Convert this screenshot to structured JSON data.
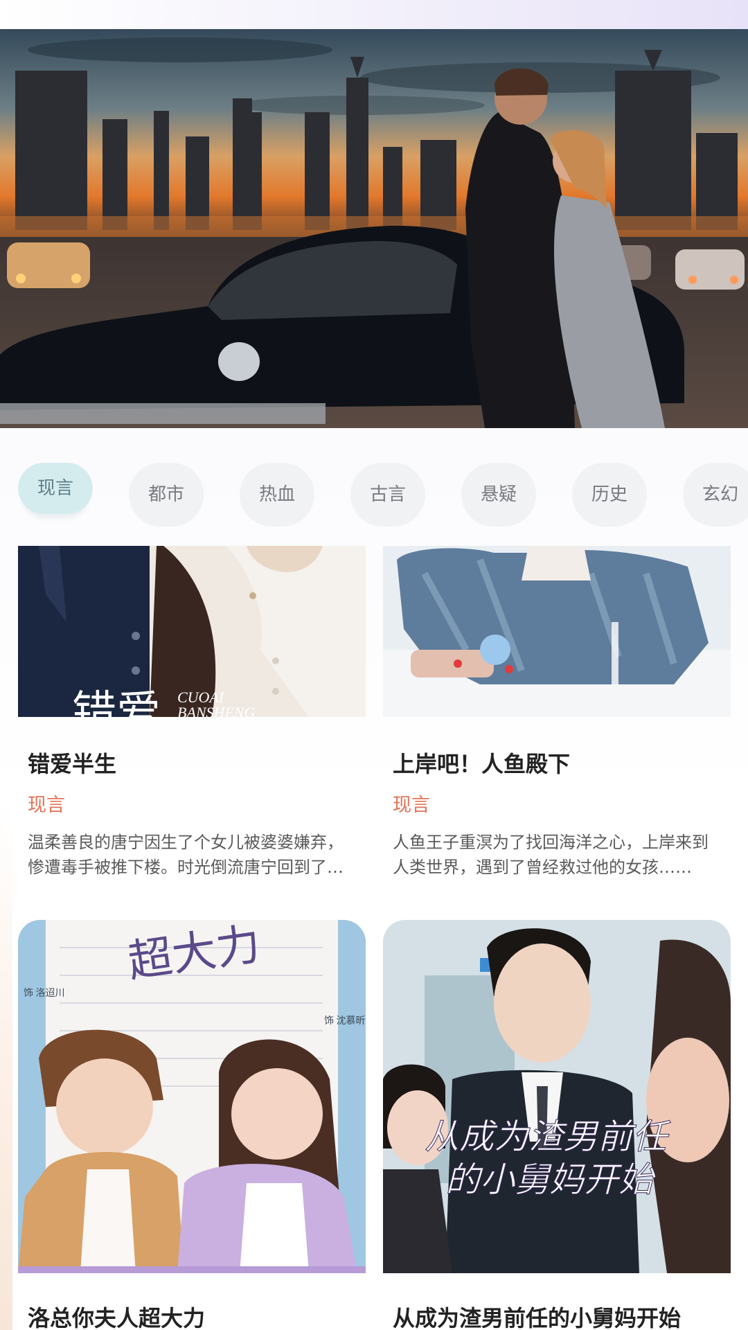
{
  "categories": [
    "现言",
    "都市",
    "热血",
    "古言",
    "悬疑",
    "历史",
    "玄幻"
  ],
  "active_category": "现言",
  "cards": [
    {
      "title": "错爱半生",
      "genre": "现言",
      "description": "温柔善良的唐宁因生了个女儿被婆婆嫌弃，惨遭毒手被推下楼。时光倒流唐宁回到了过去，这一次她决定改写自己和女儿的命运……",
      "cover_text_main": "错爱",
      "cover_text_sub1": "CUOAI",
      "cover_text_sub2": "BANSHENG"
    },
    {
      "title": "上岸吧！人鱼殿下",
      "genre": "现言",
      "description": "人鱼王子重溟为了找回海洋之心，上岸来到人类世界，遇到了曾经救过他的女孩……",
      "cover_text_main": "",
      "cover_text_sub1": "",
      "cover_text_sub2": ""
    },
    {
      "title": "洛总你夫人超大力",
      "genre": "",
      "description": "",
      "cover_text_main": "超大力",
      "cover_text_sub1": "饰 洛迢川",
      "cover_text_sub2": "饰 沈慕昕"
    },
    {
      "title": "从成为渣男前任的小舅妈开始",
      "genre": "",
      "description": "",
      "cover_text_main": "从成为渣男前任",
      "cover_text_sub1": "的小舅妈开始",
      "cover_text_sub2": ""
    }
  ],
  "colors": {
    "tab_active_bg": "#d5ecef",
    "tab_bg": "#f1f2f4",
    "genre_text": "#e07256",
    "title_text": "#222222"
  }
}
